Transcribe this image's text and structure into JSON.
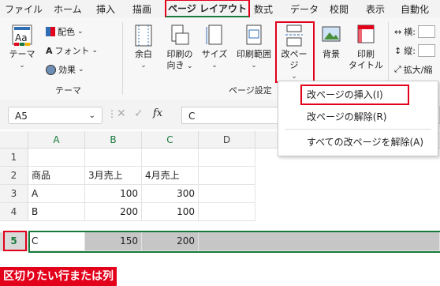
{
  "menu": [
    "ファイル",
    "ホーム",
    "挿入",
    "描画",
    "ページ レイアウト",
    "数式",
    "データ",
    "校閲",
    "表示",
    "自動化"
  ],
  "ribbon": {
    "theme": {
      "theme_label": "テーマ",
      "colors": "配色",
      "fonts": "フォント",
      "effects": "効果",
      "group": "テーマ"
    },
    "page_setup": {
      "margins": "余白",
      "orientation_1": "印刷の",
      "orientation_2": "向き",
      "size": "サイズ",
      "print_area": "印刷範囲",
      "breaks": "改ページ",
      "background": "背景",
      "print_titles_1": "印刷",
      "print_titles_2": "タイトル",
      "group": "ページ設定"
    },
    "scale": {
      "width": "横:",
      "height": "縦:",
      "scale": "拡大/縮"
    }
  },
  "formula_bar": {
    "name_box": "A5",
    "fx": "fx",
    "value": "C"
  },
  "dropdown": [
    "改ページの挿入(I)",
    "改ページの解除(R)",
    "すべての改ページを解除(A)"
  ],
  "columns": [
    "A",
    "B",
    "C",
    "D"
  ],
  "rows": [
    {
      "num": "1",
      "cells": [
        "",
        "",
        "",
        ""
      ]
    },
    {
      "num": "2",
      "cells": [
        "商品",
        "3月売上",
        "4月売上",
        ""
      ]
    },
    {
      "num": "3",
      "cells": [
        "A",
        "100",
        "300",
        ""
      ]
    },
    {
      "num": "4",
      "cells": [
        "B",
        "200",
        "100",
        ""
      ]
    },
    {
      "num": "5",
      "cells": [
        "C",
        "150",
        "200",
        ""
      ]
    }
  ],
  "caption": "区切りたい行または列",
  "colors": {
    "accent_red": "#e3001b",
    "excel_green": "#1a7a3c",
    "selection_gray": "#c6c6c6"
  }
}
